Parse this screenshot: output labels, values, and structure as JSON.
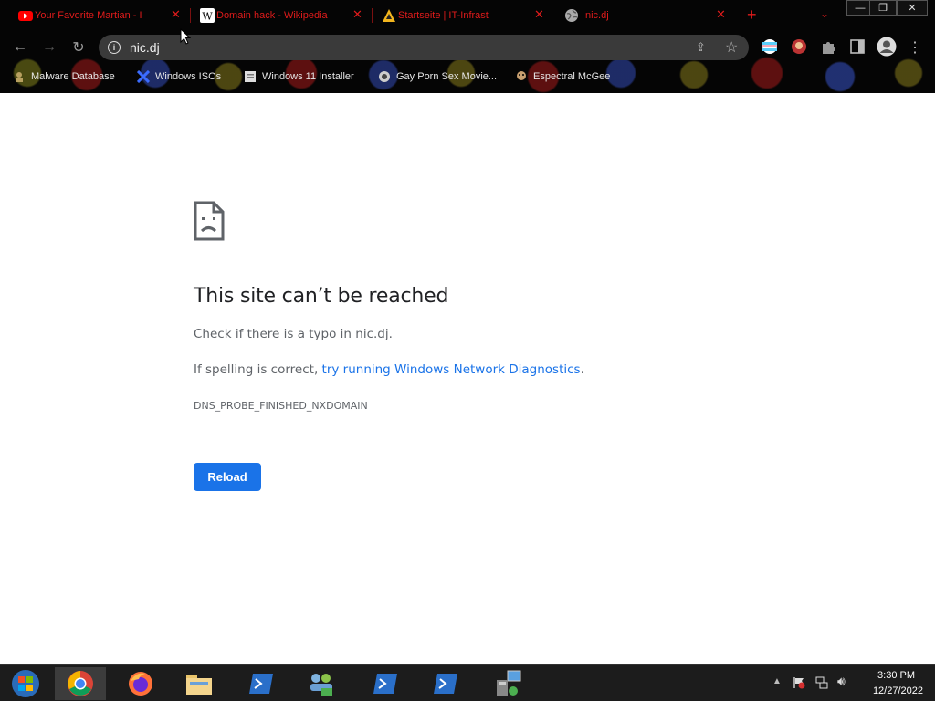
{
  "tabs": [
    {
      "title": "Your Favorite Martian - I",
      "icon": "youtube-icon"
    },
    {
      "title": "Domain hack - Wikipedia",
      "icon": "wikipedia-icon"
    },
    {
      "title": "Startseite | IT-Infrast",
      "icon": "warning-triangle-icon"
    },
    {
      "title": "nic.dj",
      "icon": "globe-icon",
      "active": true
    }
  ],
  "toolbar": {
    "url": "nic.dj"
  },
  "bookmarks": [
    {
      "label": "Malware Database"
    },
    {
      "label": "Windows ISOs"
    },
    {
      "label": "Windows 11 Installer"
    },
    {
      "label": "Gay Porn Sex Movie..."
    },
    {
      "label": "Espectral McGee"
    }
  ],
  "error_page": {
    "title": "This site can’t be reached",
    "p1": "Check if there is a typo in nic.dj.",
    "p2_prefix": "If spelling is correct, ",
    "p2_link": "try running Windows Network Diagnostics",
    "p2_suffix": ".",
    "code": "DNS_PROBE_FINISHED_NXDOMAIN",
    "reload_label": "Reload"
  },
  "taskbar": {
    "time": "3:30 PM",
    "date": "12/27/2022"
  },
  "colors": {
    "tab_text": "#e01b1b",
    "link": "#1a73e8",
    "button": "#1a73e8"
  }
}
